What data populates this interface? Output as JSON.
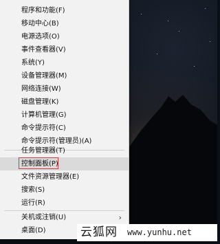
{
  "context_menu": {
    "items": [
      {
        "label": "程序和功能(F)"
      },
      {
        "label": "移动中心(B)"
      },
      {
        "label": "电源选项(O)"
      },
      {
        "label": "事件查看器(V)"
      },
      {
        "label": "系统(Y)"
      },
      {
        "label": "设备管理器(M)"
      },
      {
        "label": "网络连接(W)"
      },
      {
        "label": "磁盘管理(K)"
      },
      {
        "label": "计算机管理(G)"
      },
      {
        "label": "命令提示符(C)"
      },
      {
        "label": "命令提示符(管理员)(A)"
      },
      {
        "label": "任务管理器(T)"
      },
      {
        "label": "控制面板(P)",
        "highlighted": true
      },
      {
        "label": "文件资源管理器(E)"
      },
      {
        "label": "搜索(S)"
      },
      {
        "label": "运行(R)"
      },
      {
        "label": "关机或注销(U)",
        "has_submenu": true,
        "submenu_arrow": "›"
      },
      {
        "label": "桌面(D)"
      }
    ],
    "highlight_color": "#d23a3a"
  },
  "watermark": {
    "site_name": "云狐网",
    "url": "www.yunhu.net"
  }
}
